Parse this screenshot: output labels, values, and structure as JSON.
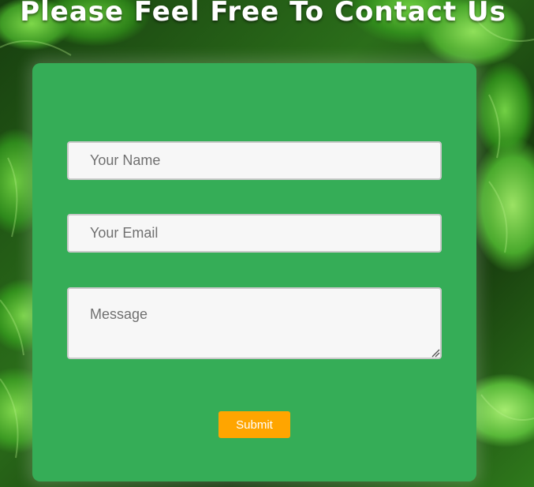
{
  "page": {
    "title": "Please Feel Free To Contact Us"
  },
  "form": {
    "name_placeholder": "Your Name",
    "email_placeholder": "Your Email",
    "message_placeholder": "Message",
    "submit_label": "Submit"
  },
  "colors": {
    "card": "#35ad57",
    "submit": "#ffa500",
    "field_bg": "#f7f7f7",
    "title_text": "#ffffff"
  },
  "icons": {
    "resize_handle": "resize-grip-icon"
  }
}
